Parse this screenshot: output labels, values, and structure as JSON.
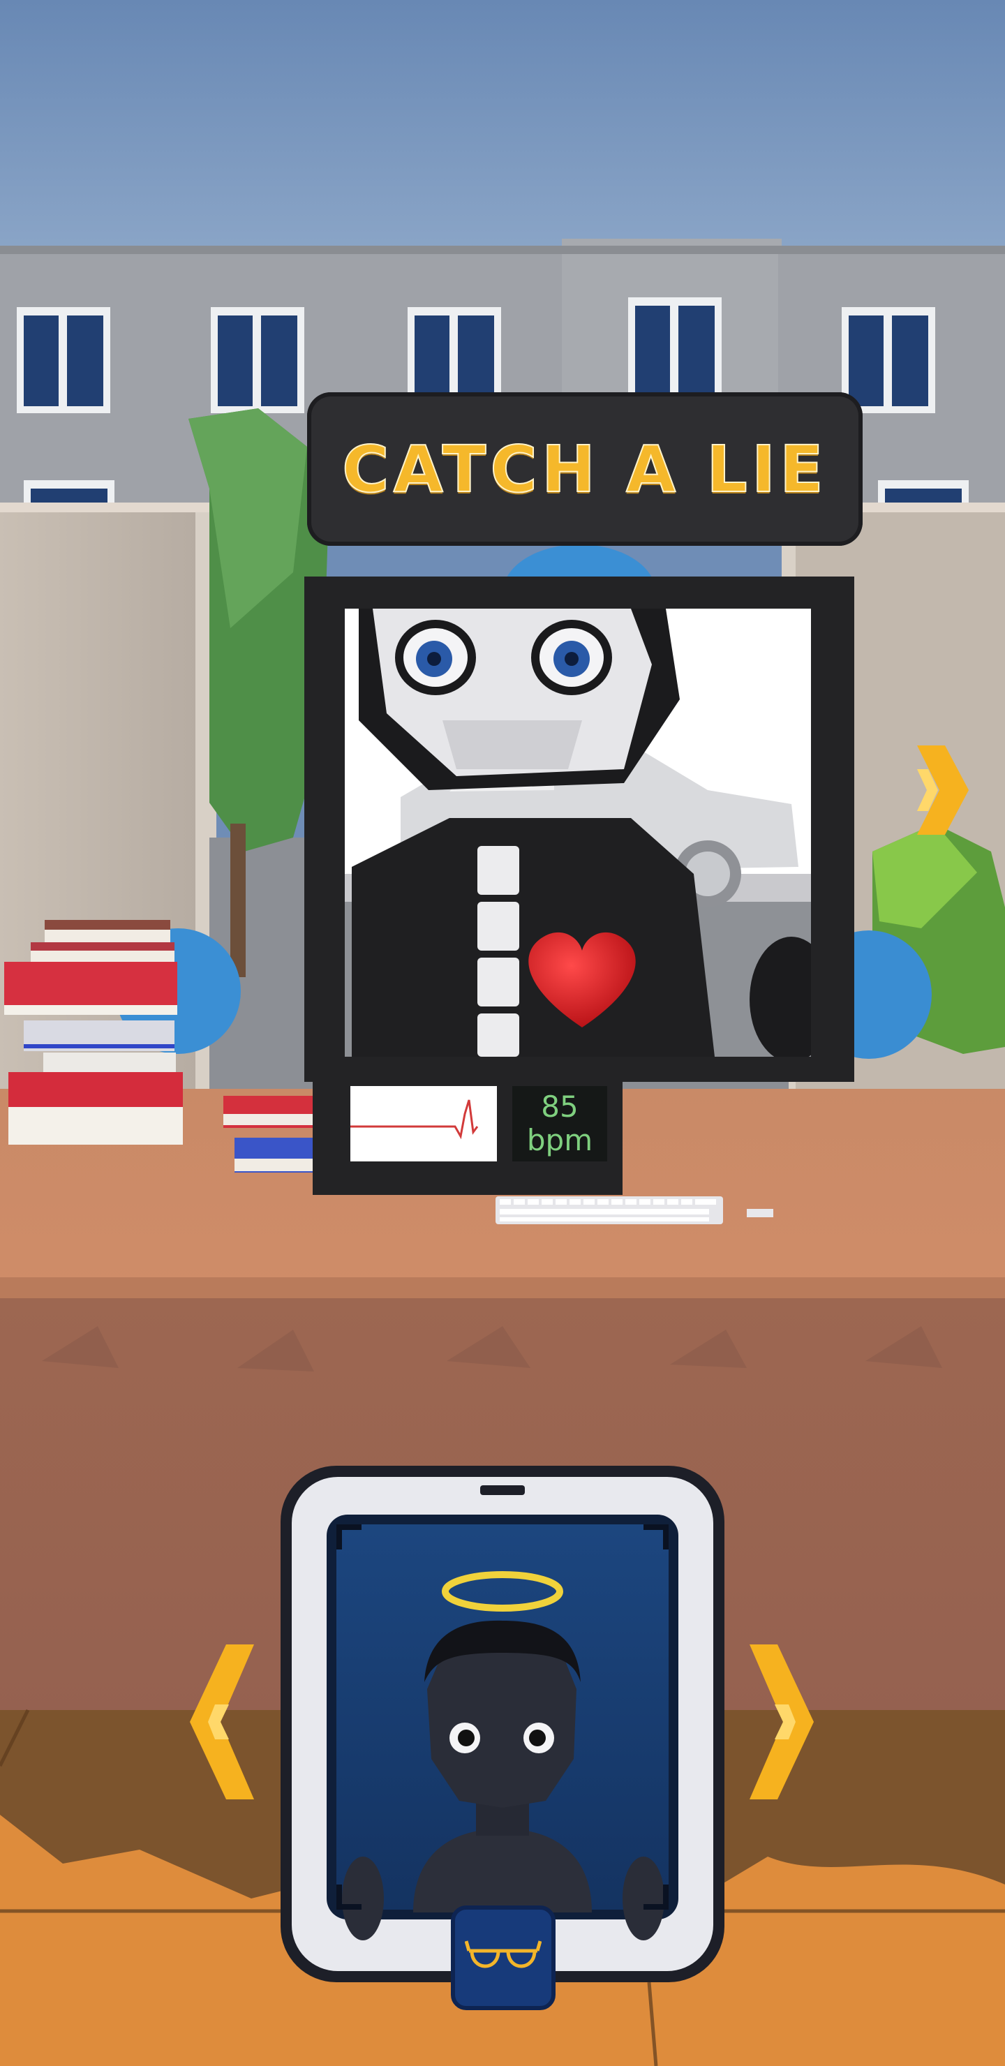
{
  "game": {
    "title": "CATCH A LIE"
  },
  "monitor": {
    "heart_rate": {
      "value": "85",
      "unit": "bpm"
    }
  },
  "navigation": {
    "scene_next_icon": "chevron-right-icon",
    "suspect_prev_icon": "chevron-left-icon",
    "suspect_next_icon": "chevron-right-icon"
  },
  "tools": {
    "active_tool_icon": "glasses-icon"
  },
  "colors": {
    "accent": "#f5b82b",
    "bpm_text": "#7fd07f",
    "sky": "#6f8db6",
    "phone_screen": "#1a3d72"
  }
}
